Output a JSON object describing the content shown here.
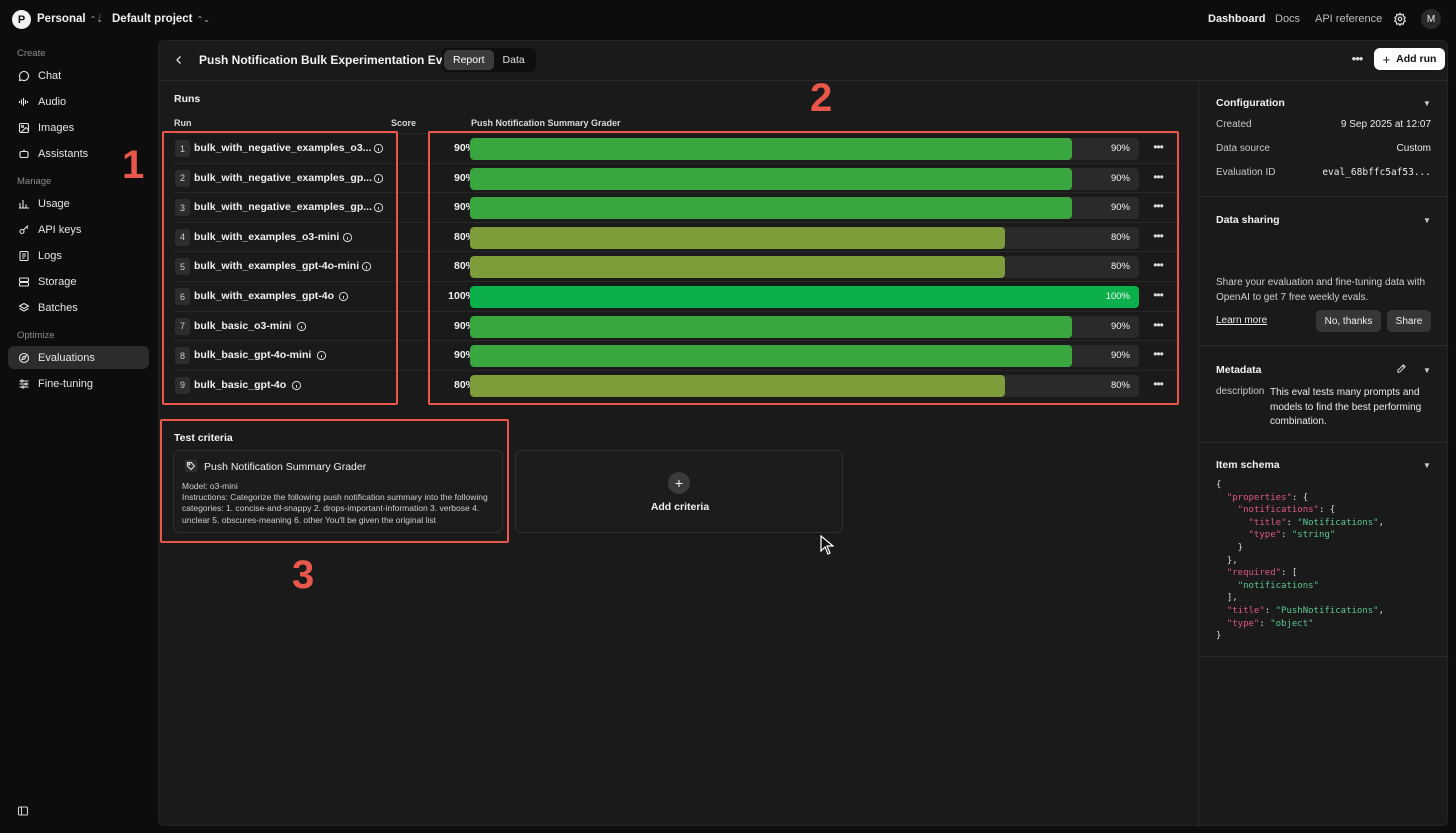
{
  "topbar": {
    "org_initial": "P",
    "org_name": "Personal",
    "separator": "/",
    "project_name": "Default project",
    "nav": [
      "Dashboard",
      "Docs",
      "API reference"
    ],
    "user_initial": "M"
  },
  "sidebar": {
    "sections": [
      {
        "title": "Create",
        "items": [
          {
            "label": "Chat",
            "icon": "chat-icon"
          },
          {
            "label": "Audio",
            "icon": "audio-icon"
          },
          {
            "label": "Images",
            "icon": "images-icon"
          },
          {
            "label": "Assistants",
            "icon": "assistants-icon"
          }
        ]
      },
      {
        "title": "Manage",
        "items": [
          {
            "label": "Usage",
            "icon": "usage-icon"
          },
          {
            "label": "API keys",
            "icon": "key-icon"
          },
          {
            "label": "Logs",
            "icon": "logs-icon"
          },
          {
            "label": "Storage",
            "icon": "storage-icon"
          },
          {
            "label": "Batches",
            "icon": "batches-icon"
          }
        ]
      },
      {
        "title": "Optimize",
        "items": [
          {
            "label": "Evaluations",
            "icon": "evaluations-icon",
            "active": true
          },
          {
            "label": "Fine-tuning",
            "icon": "fine-tuning-icon"
          }
        ]
      }
    ]
  },
  "header": {
    "title": "Push Notification Bulk Experimentation Eval",
    "tabs": [
      "Report",
      "Data"
    ],
    "active_tab": "Report",
    "add_run_label": "Add run"
  },
  "runs": {
    "section_title": "Runs",
    "col_run": "Run",
    "col_score": "Score",
    "col_grader": "Push Notification Summary Grader",
    "rows": [
      {
        "num": "1",
        "name": "bulk_with_negative_examples_o3...",
        "score": "90%",
        "pass_fraction": 0.9,
        "bar_label": "90%"
      },
      {
        "num": "2",
        "name": "bulk_with_negative_examples_gp...",
        "score": "90%",
        "pass_fraction": 0.9,
        "bar_label": "90%"
      },
      {
        "num": "3",
        "name": "bulk_with_negative_examples_gp...",
        "score": "90%",
        "pass_fraction": 0.9,
        "bar_label": "90%"
      },
      {
        "num": "4",
        "name": "bulk_with_examples_o3-mini",
        "score": "80%",
        "pass_fraction": 0.8,
        "bar_label": "80%"
      },
      {
        "num": "5",
        "name": "bulk_with_examples_gpt-4o-mini",
        "score": "80%",
        "pass_fraction": 0.8,
        "bar_label": "80%"
      },
      {
        "num": "6",
        "name": "bulk_with_examples_gpt-4o",
        "score": "100%",
        "pass_fraction": 1.0,
        "bar_label": "100%"
      },
      {
        "num": "7",
        "name": "bulk_basic_o3-mini",
        "score": "90%",
        "pass_fraction": 0.9,
        "bar_label": "90%"
      },
      {
        "num": "8",
        "name": "bulk_basic_gpt-4o-mini",
        "score": "90%",
        "pass_fraction": 0.9,
        "bar_label": "90%"
      },
      {
        "num": "9",
        "name": "bulk_basic_gpt-4o",
        "score": "80%",
        "pass_fraction": 0.8,
        "bar_label": "80%"
      }
    ],
    "colors": {
      "score_100": "#0bb04a",
      "score_90": "#3aa640",
      "score_80": "#7d9c3a"
    }
  },
  "criteria": {
    "section_title": "Test criteria",
    "card": {
      "title": "Push Notification Summary Grader",
      "model": "Model: o3-mini",
      "instructions": "Instructions: Categorize the following push notification summary into the following categories: 1. concise-and-snappy 2. drops-important-information 3. verbose 4. unclear 5. obscures-meaning 6. other You'll be given the original list"
    },
    "add_label": "Add criteria"
  },
  "config": {
    "title": "Configuration",
    "created_label": "Created",
    "created_value": "9 Sep 2025 at 12:07",
    "source_label": "Data source",
    "source_value": "Custom",
    "id_label": "Evaluation ID",
    "id_value": "eval_68bffc5af53..."
  },
  "sharing": {
    "title": "Data sharing",
    "text": "Share your evaluation and fine-tuning data with OpenAI to get 7 free weekly evals.",
    "learn_more": "Learn more",
    "decline": "No, thanks",
    "accept": "Share"
  },
  "metadata": {
    "title": "Metadata",
    "key": "description",
    "value": "This eval tests many prompts and models to find the best performing combination."
  },
  "schema": {
    "title": "Item schema",
    "lines": [
      [
        [
          "p",
          "{"
        ]
      ],
      [
        [
          "p",
          "  "
        ],
        [
          "k",
          "\"properties\""
        ],
        [
          "p",
          ": {"
        ]
      ],
      [
        [
          "p",
          "    "
        ],
        [
          "k",
          "\"notifications\""
        ],
        [
          "p",
          ": {"
        ]
      ],
      [
        [
          "p",
          "      "
        ],
        [
          "k",
          "\"title\""
        ],
        [
          "p",
          ": "
        ],
        [
          "s",
          "\"Notifications\""
        ],
        [
          "p",
          ","
        ]
      ],
      [
        [
          "p",
          "      "
        ],
        [
          "k",
          "\"type\""
        ],
        [
          "p",
          ": "
        ],
        [
          "s",
          "\"string\""
        ]
      ],
      [
        [
          "p",
          "    }"
        ]
      ],
      [
        [
          "p",
          "  },"
        ]
      ],
      [
        [
          "p",
          "  "
        ],
        [
          "k",
          "\"required\""
        ],
        [
          "p",
          ": ["
        ]
      ],
      [
        [
          "p",
          "    "
        ],
        [
          "s",
          "\"notifications\""
        ]
      ],
      [
        [
          "p",
          "  ],"
        ]
      ],
      [
        [
          "p",
          "  "
        ],
        [
          "k",
          "\"title\""
        ],
        [
          "p",
          ": "
        ],
        [
          "s",
          "\"PushNotifications\""
        ],
        [
          "p",
          ","
        ]
      ],
      [
        [
          "p",
          "  "
        ],
        [
          "k",
          "\"type\""
        ],
        [
          "p",
          ": "
        ],
        [
          "s",
          "\"object\""
        ]
      ],
      [
        [
          "p",
          "}"
        ]
      ]
    ]
  },
  "annotations": {
    "labels": [
      "1",
      "2",
      "3"
    ],
    "color": "#e8574a"
  }
}
